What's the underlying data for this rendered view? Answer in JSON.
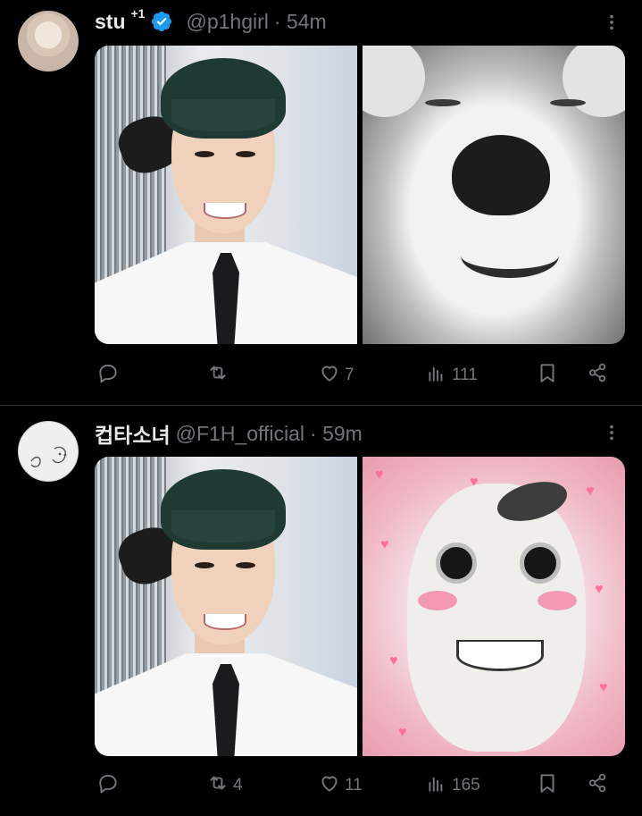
{
  "tweets": [
    {
      "display_name": "stu",
      "name_suffix": "+1",
      "verified": true,
      "handle": "@p1hgirl",
      "time": "· 54m",
      "metrics": {
        "replies": "",
        "retweets": "",
        "likes": "7",
        "views": "111"
      }
    },
    {
      "display_name": "컵타소녀",
      "name_suffix": "",
      "verified": false,
      "handle": "@F1H_official",
      "time": "· 59m",
      "metrics": {
        "replies": "",
        "retweets": "4",
        "likes": "11",
        "views": "165"
      }
    }
  ],
  "colors": {
    "background": "#000000",
    "text": "#e7e9ea",
    "muted": "#71767b",
    "verified": "#1d9bf0",
    "divider": "#2f3336"
  },
  "icons": [
    "more-icon",
    "reply-icon",
    "retweet-icon",
    "like-icon",
    "views-icon",
    "bookmark-icon",
    "share-icon",
    "verified-badge-icon"
  ]
}
